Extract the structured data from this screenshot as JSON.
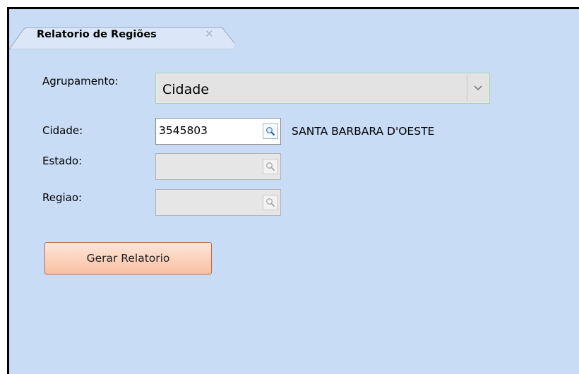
{
  "tab": {
    "title": "Relatorio de Regiões",
    "close_glyph": "✕"
  },
  "form": {
    "agrupamento": {
      "label": "Agrupamento:",
      "value": "Cidade"
    },
    "cidade": {
      "label": "Cidade:",
      "value": "3545803",
      "description": "SANTA BARBARA D'OESTE"
    },
    "estado": {
      "label": "Estado:",
      "value": ""
    },
    "regiao": {
      "label": "Regiao:",
      "value": ""
    }
  },
  "actions": {
    "generate_label": "Gerar Relatorio"
  },
  "icons": {
    "tab_close": "close-icon",
    "dropdown": "chevron-down-icon",
    "lookup": "magnifier-icon"
  },
  "colors": {
    "panel_bg": "#c9dcf6",
    "button_bg": "#fac0a2",
    "combo_border": "#a9cfb1"
  }
}
